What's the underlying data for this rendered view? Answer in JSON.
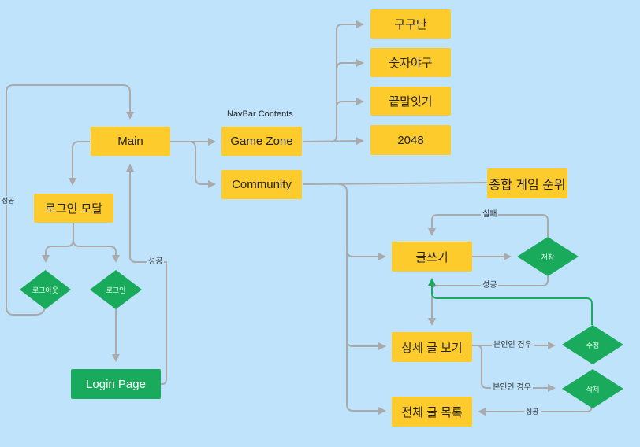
{
  "colors": {
    "background": "#bfe3fb",
    "page_node": "#fecb2d",
    "decision_node": "#19ab5b",
    "edge": "#aaaaaa",
    "highlight_edge": "#19ab5b"
  },
  "section_title": "NavBar Contents",
  "nodes": {
    "main": "Main",
    "login_modal": "로그인 모달",
    "logout": "로그아웃",
    "login": "로그인",
    "login_page": "Login Page",
    "game_zone": "Game Zone",
    "community": "Community",
    "gugudan": "구구단",
    "baseball": "숫자야구",
    "word_chain": "끝말잇기",
    "g2048": "2048",
    "ranking": "종합 게임 순위",
    "write": "글쓰기",
    "save": "저장",
    "detail": "상세 글 보기",
    "edit": "수정",
    "delete": "삭제",
    "list": "전체 글 목록"
  },
  "edge_labels": {
    "logout_success": "성공",
    "login_success": "성공",
    "save_fail": "실패",
    "save_success": "성공",
    "own_edit": "본인인 경우",
    "own_delete": "본인인 경우",
    "delete_success": "성공"
  }
}
